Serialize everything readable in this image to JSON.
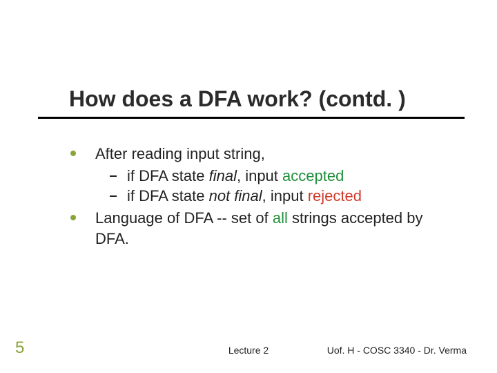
{
  "slide": {
    "title": "How does a DFA work? (contd. )",
    "bullets": [
      {
        "text": "After reading input string,",
        "sub": [
          {
            "pre": "if DFA state ",
            "em": "final",
            "mid": ", input ",
            "kw": "accepted",
            "kw_color": "#1f8f3a"
          },
          {
            "pre": "if DFA state ",
            "em": "not final",
            "mid": ", input ",
            "kw": "rejected",
            "kw_color": "#d03a2a"
          }
        ]
      },
      {
        "segments": [
          {
            "t": "Language of DFA -- set of "
          },
          {
            "t": "all",
            "color": "#1f8f3a"
          },
          {
            "t": " strings accepted by DFA."
          }
        ]
      }
    ]
  },
  "footer": {
    "page": "5",
    "center": "Lecture 2",
    "right": "Uof. H - COSC 3340 - Dr. Verma"
  }
}
